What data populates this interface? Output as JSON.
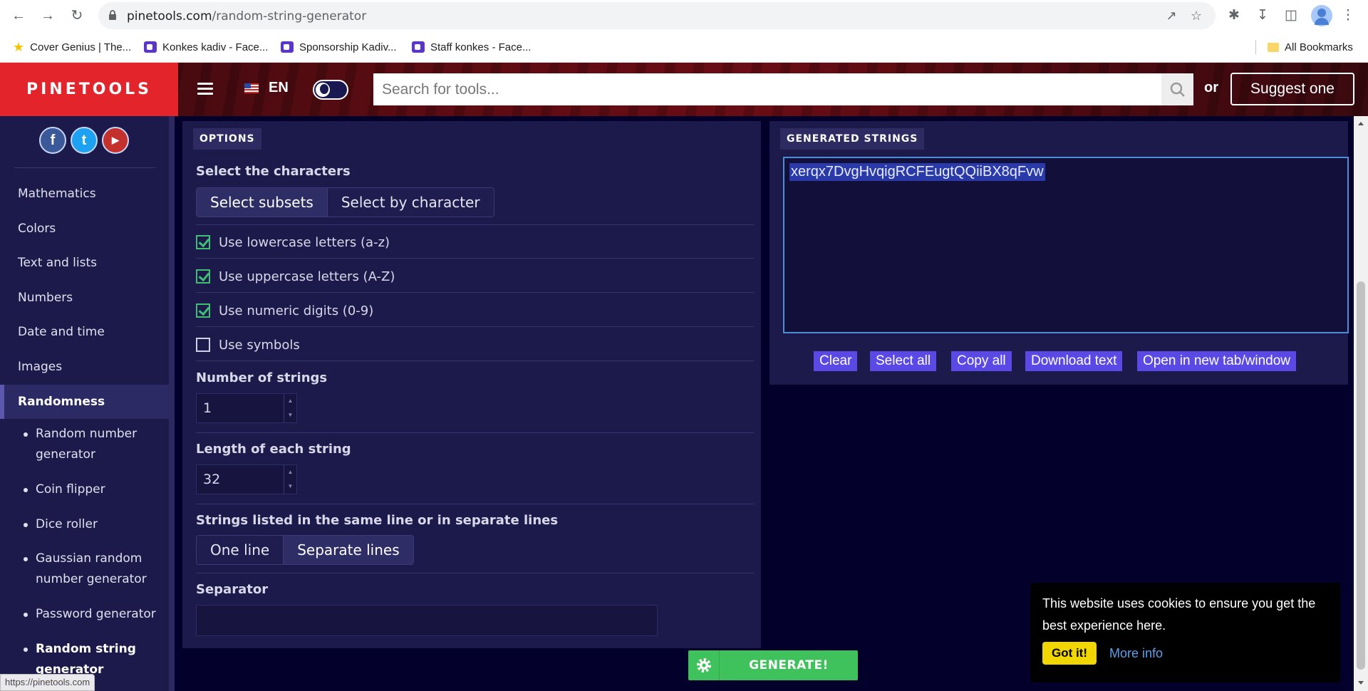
{
  "browser": {
    "url_domain": "pinetools.com",
    "url_path": "/random-string-generator",
    "bookmarks": [
      {
        "label": "Cover Genius | The..."
      },
      {
        "label": "Konkes kadiv - Face..."
      },
      {
        "label": "Sponsorship Kadiv..."
      },
      {
        "label": "Staff konkes - Face..."
      }
    ],
    "all_bookmarks": "All Bookmarks",
    "status_url": "https://pinetools.com"
  },
  "header": {
    "logo": "PINETOOLS",
    "language": "EN",
    "search_placeholder": "Search for tools...",
    "or": "or",
    "suggest": "Suggest one"
  },
  "sidebar": {
    "social": [
      "f",
      "t",
      "▶"
    ],
    "categories": [
      "Mathematics",
      "Colors",
      "Text and lists",
      "Numbers",
      "Date and time",
      "Images"
    ],
    "active": "Randomness",
    "sub_items": [
      "Random number generator",
      "Coin flipper",
      "Dice roller",
      "Gaussian random number generator",
      "Password generator",
      "Random string generator"
    ]
  },
  "options": {
    "title": "OPTIONS",
    "select_chars_label": "Select the characters",
    "select_subsets": "Select subsets",
    "select_by_char": "Select by character",
    "checkboxes": [
      {
        "label": "Use lowercase letters (a-z)",
        "checked": true
      },
      {
        "label": "Use uppercase letters (A-Z)",
        "checked": true
      },
      {
        "label": "Use numeric digits (0-9)",
        "checked": true
      },
      {
        "label": "Use symbols",
        "checked": false
      }
    ],
    "num_strings_label": "Number of strings",
    "num_strings": "1",
    "length_label": "Length of each string",
    "length": "32",
    "lines_label": "Strings listed in the same line or in separate lines",
    "one_line": "One line",
    "separate_lines": "Separate lines",
    "separator_label": "Separator",
    "separator": ""
  },
  "generated": {
    "title": "GENERATED STRINGS",
    "value": "xerqx7DvgHvqigRCFEugtQQiiBX8qFvw",
    "buttons": [
      "Clear",
      "Select all",
      "Copy all",
      "Download text",
      "Open in new tab/window"
    ]
  },
  "generate_button": "GENERATE!",
  "cookie": {
    "message": "This website uses cookies to ensure you get the best experience here.",
    "got_it": "Got it!",
    "more_info": "More info"
  },
  "colors": {
    "brand_red": "#e3242b",
    "panel_bg": "#1c1a4a",
    "page_bg": "#03012b",
    "generate_green": "#3fc25c",
    "button_purple": "#5b49e6"
  }
}
